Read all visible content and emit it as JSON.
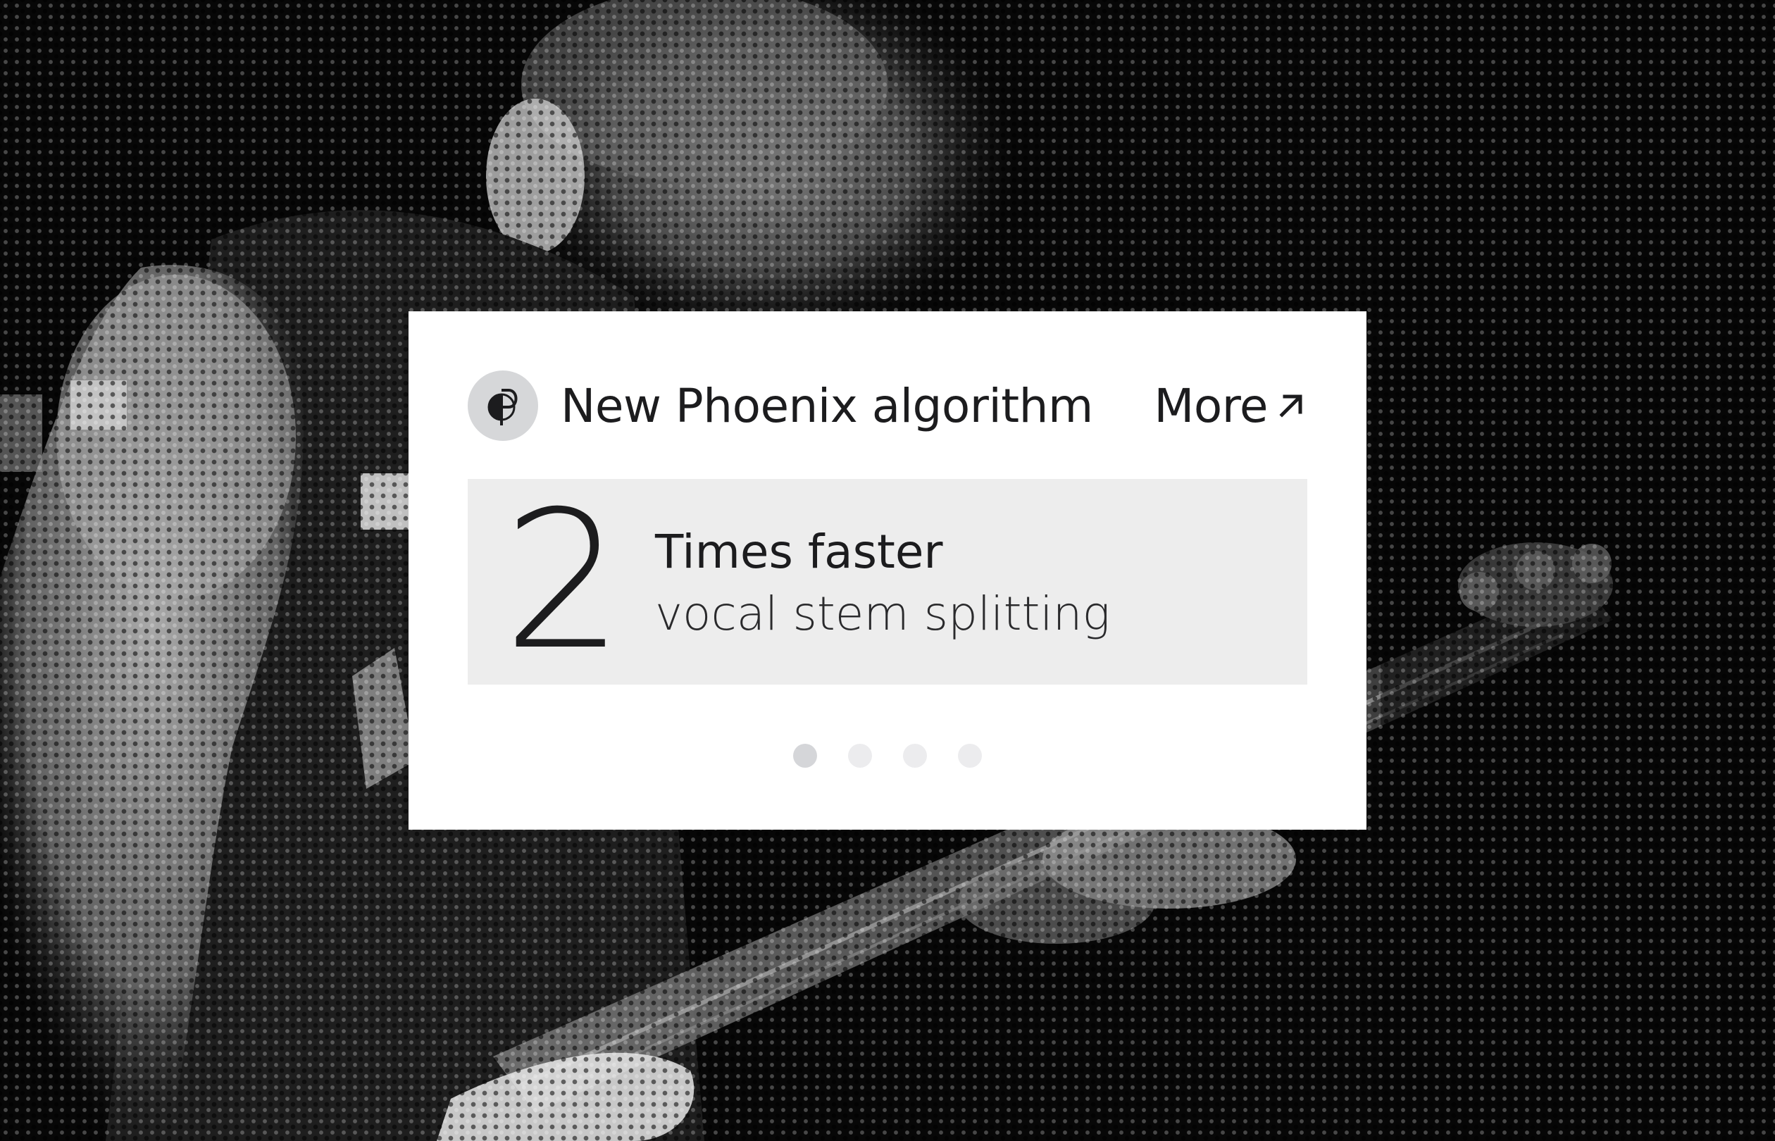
{
  "card": {
    "title": "New Phoenix algorithm",
    "more_label": "More",
    "logo_icon": "phoenix-logo-icon",
    "more_icon": "arrow-up-right-icon"
  },
  "stat": {
    "number": "2",
    "label": "Times faster",
    "sub_label": "vocal stem splitting"
  },
  "carousel": {
    "slide_count": 4,
    "active_index": 0
  },
  "colors": {
    "card_bg": "#ffffff",
    "panel_bg": "#ededed",
    "text": "#1c1c1e",
    "logo_bg": "#d6d7d9",
    "dot_active": "#d5d6d9",
    "dot_inactive": "#ececee"
  }
}
